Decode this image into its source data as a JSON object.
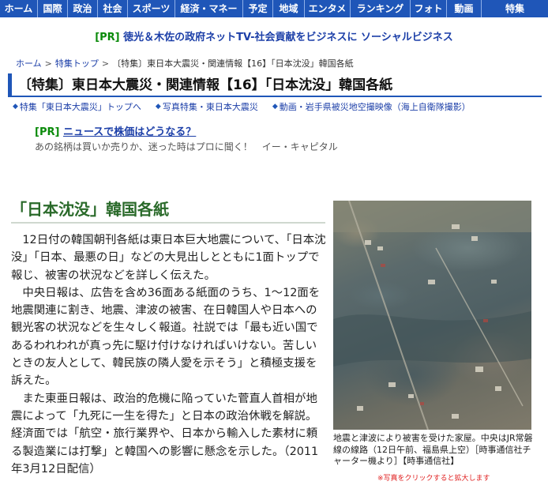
{
  "nav": {
    "items": [
      "ホーム",
      "国際",
      "政治",
      "社会",
      "スポーツ",
      "経済・マネー",
      "予定",
      "地域",
      "エンタメ",
      "ランキング",
      "フォト",
      "動画",
      "特集"
    ]
  },
  "pr_top": {
    "tag": "[PR]",
    "text": "徳光＆木佐の政府ネットTV-社会貢献をビジネスに ソーシャルビジネス"
  },
  "breadcrumb": {
    "home": "ホーム",
    "sep1": ">",
    "feature_top": "特集トップ",
    "sep2": ">",
    "current": "〔特集〕東日本大震災・関連情報【16】「日本沈没」韓国各紙"
  },
  "title": "〔特集〕東日本大震災・関連情報【16】「日本沈没」韓国各紙",
  "related_links": [
    "特集「東日本大震災」トップへ",
    "写真特集・東日本大震災",
    "動画・岩手県被災地空撮映像（海上自衛隊撮影）"
  ],
  "pr_mid": {
    "tag": "[PR]",
    "link": "ニュースで株価はどうなる？",
    "desc": "あの銘柄は買いか売りか、迷った時はプロに聞く！　イー・キャピタル"
  },
  "article": {
    "heading": "「日本沈没」韓国各紙",
    "paragraphs": [
      "12日付の韓国朝刊各紙は東日本巨大地震について、「日本沈没」「日本、最悪の日」などの大見出しとともに1面トップで報じ、被害の状況などを詳しく伝えた。",
      "中央日報は、広告を含め36面ある紙面のうち、1～12面を地震関連に割き、地震、津波の被害、在日韓国人や日本への観光客の状況などを生々しく報道。社説では「最も近い国であるわれわれが真っ先に駆け付けなければいけない。苦しいときの友人として、韓民族の隣人愛を示そう」と積極支援を訴えた。",
      "また東亜日報は、政治的危機に陥っていた菅直人首相が地震によって「九死に一生を得た」と日本の政治休戦を解説。経済面では「航空・旅行業界や、日本から輸入した素材に頼る製造業には打撃」と韓国への影響に懸念を示した。（2011年3月12日配信）"
    ]
  },
  "photo": {
    "caption": "地震と津波により被害を受けた家屋。中央はJR常磐線の線路（12日午前、福島県上空）［時事通信社チャーター機より］【時事通信社】",
    "zoom_note": "※写真をクリックすると拡大します"
  },
  "colors": {
    "nav_bg": "#1f56b8",
    "pr_tag": "#0a8a0a",
    "link": "#1c3fa8",
    "heading_green": "#2a6a2a",
    "alert_red": "#e02020"
  }
}
